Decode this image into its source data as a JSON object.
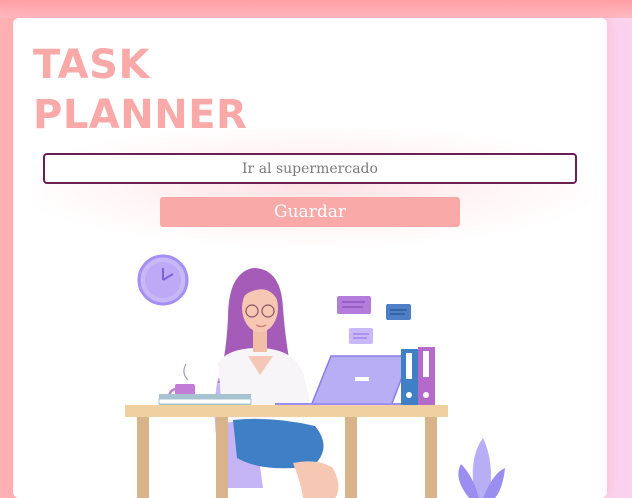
{
  "app": {
    "title_line1": "TASK",
    "title_line2": "PLANNER"
  },
  "task_form": {
    "placeholder": "Ir al supermercado",
    "save_label": "Guardar"
  },
  "colors": {
    "accent": "#f9a9a8",
    "input_border": "#6b1f4e",
    "background_left": "#ffb1b3",
    "background_right": "#fbd3ef"
  },
  "illustration": {
    "subject": "woman-working-at-desk-illustration",
    "icons": [
      "wall-clock-icon",
      "chat-bubble-icon",
      "laptop-icon",
      "coffee-mug-icon",
      "binder-icon",
      "plant-icon"
    ]
  }
}
